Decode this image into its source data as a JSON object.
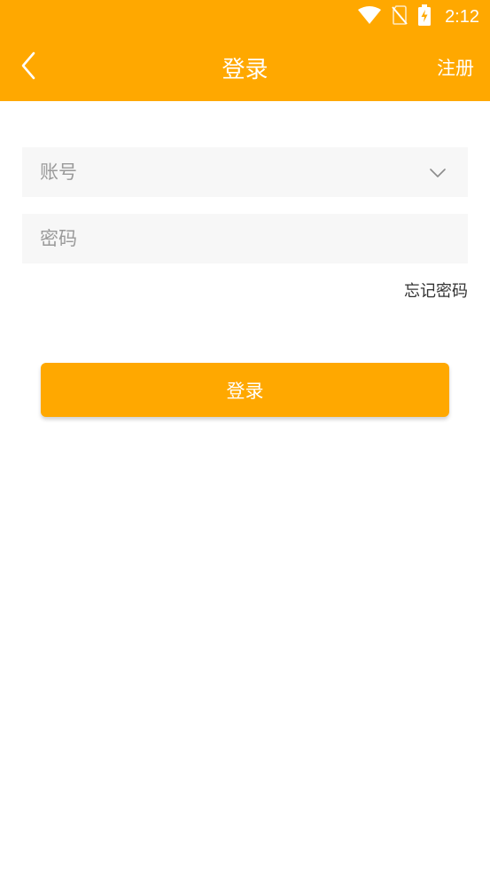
{
  "status_bar": {
    "time": "2:12",
    "icons": [
      "wifi-icon",
      "no-sim-icon",
      "battery-charging-icon"
    ]
  },
  "navbar": {
    "back_icon": "chevron-left-icon",
    "title": "登录",
    "register_label": "注册"
  },
  "form": {
    "account": {
      "value": "",
      "placeholder": "账号",
      "dropdown_icon": "chevron-down-icon"
    },
    "password": {
      "value": "",
      "placeholder": "密码"
    },
    "forgot_label": "忘记密码",
    "login_label": "登录"
  },
  "colors": {
    "accent": "#FFA800",
    "field_bg": "#F7F7F7",
    "placeholder": "#9A9A9A"
  }
}
